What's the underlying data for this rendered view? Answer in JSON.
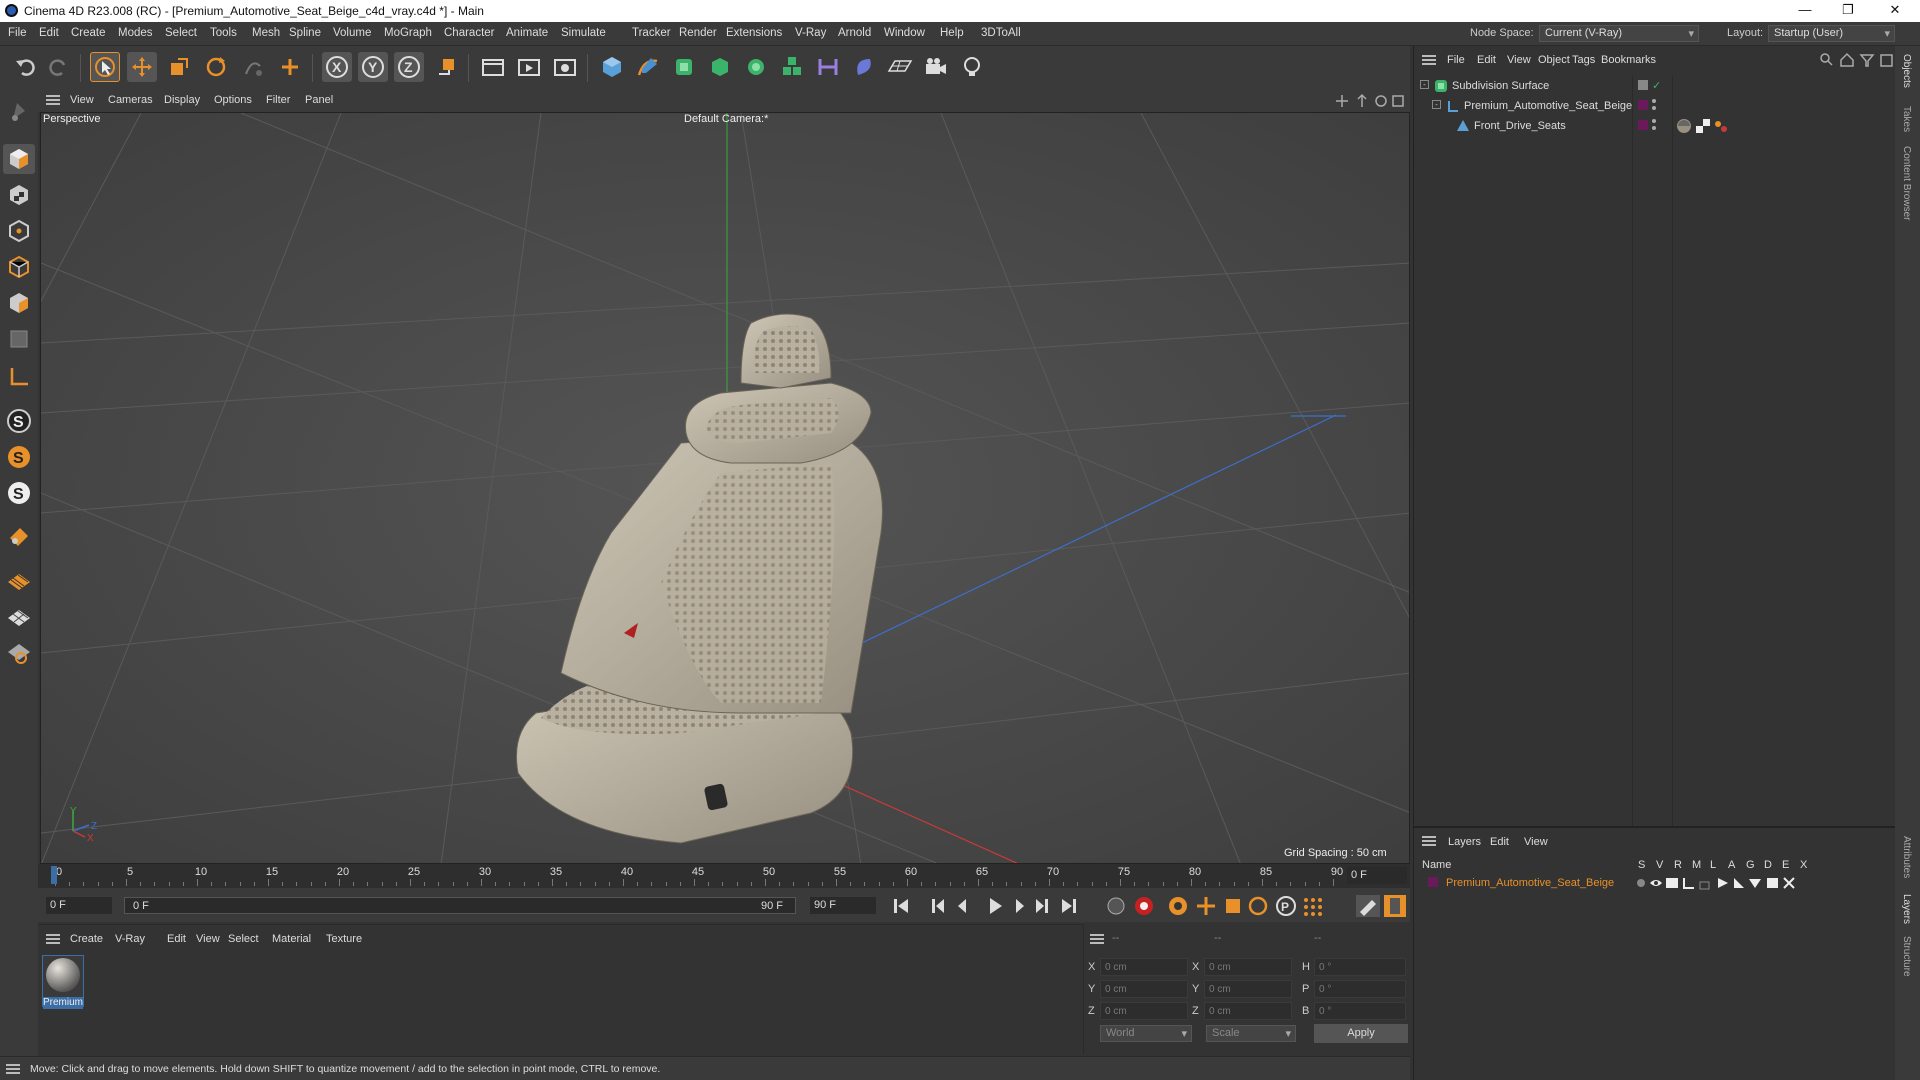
{
  "window": {
    "title": "Cinema 4D R23.008 (RC) - [Premium_Automotive_Seat_Beige_c4d_vray.c4d *] - Main"
  },
  "menu": {
    "items": [
      "File",
      "Edit",
      "Create",
      "Modes",
      "Select",
      "Tools",
      "Mesh",
      "Spline",
      "Volume",
      "MoGraph",
      "Character",
      "Animate",
      "Simulate",
      "Tracker",
      "Render",
      "Extensions",
      "V-Ray",
      "Arnold",
      "Window",
      "Help",
      "3DToAll"
    ],
    "node_space_label": "Node Space:",
    "node_space_value": "Current (V-Ray)",
    "layout_label": "Layout:",
    "layout_value": "Startup (User)"
  },
  "viewport": {
    "menu": [
      "View",
      "Cameras",
      "Display",
      "Options",
      "Filter",
      "Panel"
    ],
    "label": "Perspective",
    "camera": "Default Camera",
    "camera_suffix": ":*",
    "grid_spacing": "Grid Spacing : 50 cm",
    "axis_y": "Y",
    "axis_z": "Z",
    "axis_x": "X"
  },
  "timeline": {
    "ticks": [
      "0",
      "5",
      "10",
      "15",
      "20",
      "25",
      "30",
      "35",
      "40",
      "45",
      "50",
      "55",
      "60",
      "65",
      "70",
      "75",
      "80",
      "85",
      "90"
    ],
    "current_frame": "0 F",
    "start_field": "0 F",
    "range_start": "0 F",
    "range_end": "90 F",
    "end_field": "90 F"
  },
  "material_panel": {
    "menu": [
      "Create",
      "V-Ray",
      "Edit",
      "View",
      "Select",
      "Material",
      "Texture"
    ],
    "material_name": "Premium"
  },
  "coords": {
    "header": [
      "--",
      "--",
      "--"
    ],
    "rows": [
      {
        "l1": "X",
        "v1": "0 cm",
        "l2": "X",
        "v2": "0 cm",
        "l3": "H",
        "v3": "0 °"
      },
      {
        "l1": "Y",
        "v1": "0 cm",
        "l2": "Y",
        "v2": "0 cm",
        "l3": "P",
        "v3": "0 °"
      },
      {
        "l1": "Z",
        "v1": "0 cm",
        "l2": "Z",
        "v2": "0 cm",
        "l3": "B",
        "v3": "0 °"
      }
    ],
    "space": "World",
    "mode": "Scale",
    "apply": "Apply"
  },
  "status": {
    "text": "Move: Click and drag to move elements. Hold down SHIFT to quantize movement / add to the selection in point mode, CTRL to remove."
  },
  "object_manager": {
    "menu": [
      "File",
      "Edit",
      "View",
      "Object",
      "Tags",
      "Bookmarks"
    ],
    "objects": [
      {
        "name": "Subdivision Surface"
      },
      {
        "name": "Premium_Automotive_Seat_Beige"
      },
      {
        "name": "Front_Drive_Seats"
      }
    ]
  },
  "layer_manager": {
    "menu": [
      "Layers",
      "Edit",
      "View"
    ],
    "col_name": "Name",
    "cols": [
      "S",
      "V",
      "R",
      "M",
      "L",
      "A",
      "G",
      "D",
      "E",
      "X"
    ],
    "layers": [
      {
        "name": "Premium_Automotive_Seat_Beige",
        "color": "#7a3a8a"
      }
    ]
  },
  "side_tabs": [
    "Objects",
    "Takes",
    "Content Browser",
    "Attributes",
    "Layers",
    "Structure"
  ],
  "colors": {
    "accent": "#e8902a",
    "select_blue": "#3a6ea5",
    "layer_text": "#e8902a"
  }
}
